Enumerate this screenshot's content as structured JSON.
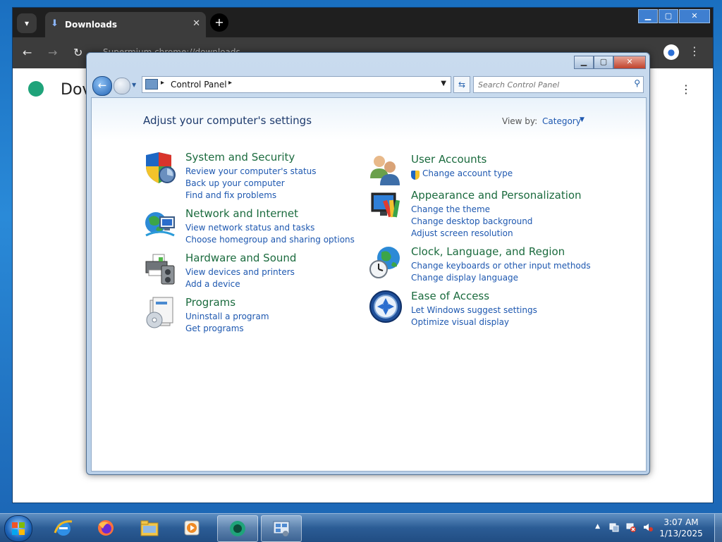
{
  "browser": {
    "tab_title": "Downloads",
    "omnibox_text": "Supermium  chrome://downloads",
    "page_title": "Dov"
  },
  "control_panel": {
    "address": {
      "crumb": "Control Panel"
    },
    "search_placeholder": "Search Control Panel",
    "heading": "Adjust your computer's settings",
    "view_by_label": "View by:",
    "view_by_value": "Category",
    "categories": [
      {
        "title": "System and Security",
        "links": [
          "Review your computer's status",
          "Back up your computer",
          "Find and fix problems"
        ]
      },
      {
        "title": "Network and Internet",
        "links": [
          "View network status and tasks",
          "Choose homegroup and sharing options"
        ]
      },
      {
        "title": "Hardware and Sound",
        "links": [
          "View devices and printers",
          "Add a device"
        ]
      },
      {
        "title": "Programs",
        "links": [
          "Uninstall a program",
          "Get programs"
        ]
      },
      {
        "title": "User Accounts",
        "links": [
          "Change account type"
        ]
      },
      {
        "title": "Appearance and Personalization",
        "links": [
          "Change the theme",
          "Change desktop background",
          "Adjust screen resolution"
        ]
      },
      {
        "title": "Clock, Language, and Region",
        "links": [
          "Change keyboards or other input methods",
          "Change display language"
        ]
      },
      {
        "title": "Ease of Access",
        "links": [
          "Let Windows suggest settings",
          "Optimize visual display"
        ]
      }
    ]
  },
  "taskbar": {
    "items": [
      "start-button",
      "internet-explorer",
      "firefox",
      "file-explorer",
      "media-player",
      "supermium-browser",
      "control-panel"
    ],
    "clock_time": "3:07 AM",
    "clock_date": "1/13/2025"
  }
}
